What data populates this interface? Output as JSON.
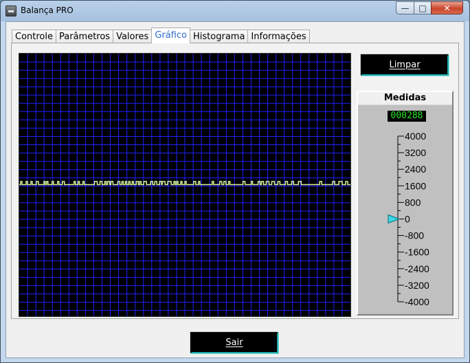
{
  "window": {
    "title": "Balança PRO"
  },
  "tabs": [
    {
      "label": "Controle",
      "active": false
    },
    {
      "label": "Parâmetros",
      "active": false
    },
    {
      "label": "Valores",
      "active": false
    },
    {
      "label": "Gráfico",
      "active": true
    },
    {
      "label": "Histograma",
      "active": false
    },
    {
      "label": "Informações",
      "active": false
    }
  ],
  "buttons": {
    "clear_label": "Limpar",
    "exit_label": "Sair"
  },
  "gauge": {
    "title": "Medidas",
    "readout": "000288",
    "ticks": [
      "4000",
      "3200",
      "2400",
      "1600",
      "800",
      "0",
      "-800",
      "-1600",
      "-2400",
      "-3200",
      "-4000"
    ],
    "value": 0,
    "min": -4000,
    "max": 4000,
    "pointer_color": "#39d6e6"
  },
  "graph": {
    "background_color": "#000000",
    "grid_color": "#2020ff",
    "trace_color": "#d8f5a0",
    "baseline": 0,
    "pulse_level": 1,
    "pulses": [
      [
        2,
        4
      ],
      [
        10,
        12
      ],
      [
        17,
        19
      ],
      [
        25,
        28
      ],
      [
        36,
        38
      ],
      [
        40,
        42
      ],
      [
        48,
        50
      ],
      [
        56,
        58
      ],
      [
        63,
        66
      ],
      [
        80,
        82
      ],
      [
        86,
        88
      ],
      [
        93,
        95
      ],
      [
        110,
        114
      ],
      [
        118,
        121
      ],
      [
        125,
        127
      ],
      [
        129,
        132
      ],
      [
        134,
        137
      ],
      [
        144,
        147
      ],
      [
        150,
        152
      ],
      [
        155,
        157
      ],
      [
        160,
        162
      ],
      [
        165,
        167
      ],
      [
        171,
        174
      ],
      [
        176,
        178
      ],
      [
        182,
        186
      ],
      [
        192,
        195
      ],
      [
        198,
        201
      ],
      [
        205,
        208
      ],
      [
        209,
        213
      ],
      [
        217,
        222
      ],
      [
        226,
        228
      ],
      [
        230,
        232
      ],
      [
        236,
        238
      ],
      [
        242,
        244
      ],
      [
        255,
        258
      ],
      [
        262,
        264
      ],
      [
        282,
        284
      ],
      [
        293,
        296
      ],
      [
        299,
        302
      ],
      [
        306,
        308
      ],
      [
        327,
        330
      ],
      [
        339,
        341
      ],
      [
        349,
        352
      ],
      [
        354,
        357
      ],
      [
        361,
        365
      ],
      [
        369,
        373
      ],
      [
        378,
        381
      ],
      [
        389,
        392
      ],
      [
        398,
        401
      ],
      [
        408,
        412
      ],
      [
        439,
        442
      ],
      [
        458,
        461
      ],
      [
        467,
        472
      ],
      [
        477,
        480
      ],
      [
        486,
        489
      ]
    ],
    "length": 484
  }
}
